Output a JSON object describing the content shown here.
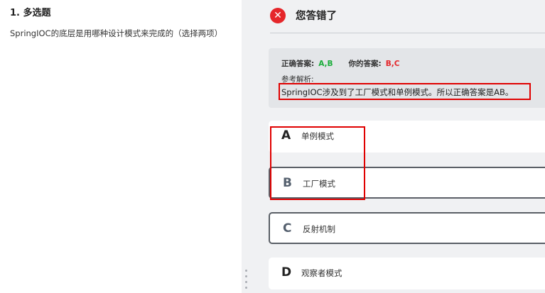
{
  "question": {
    "number_title": "1. 多选题",
    "text": "SpringIOC的底层是用哪种设计模式来完成的（选择两项）"
  },
  "result": {
    "title": "您答错了",
    "icon": "x-circle-icon"
  },
  "answers": {
    "correct_label": "正确答案:",
    "correct_value": "A,B",
    "your_label": "你的答案:",
    "your_value": "B,C"
  },
  "analysis": {
    "label": "参考解析:",
    "text": "SpringIOC涉及到了工厂模式和单例模式。所以正确答案是AB。"
  },
  "options": [
    {
      "letter": "A",
      "text": "单例模式"
    },
    {
      "letter": "B",
      "text": "工厂模式"
    },
    {
      "letter": "C",
      "text": "反射机制"
    },
    {
      "letter": "D",
      "text": "观察者模式"
    }
  ],
  "colors": {
    "correct": "#1aad3a",
    "wrong": "#e5262a",
    "annotation": "#e00000"
  }
}
